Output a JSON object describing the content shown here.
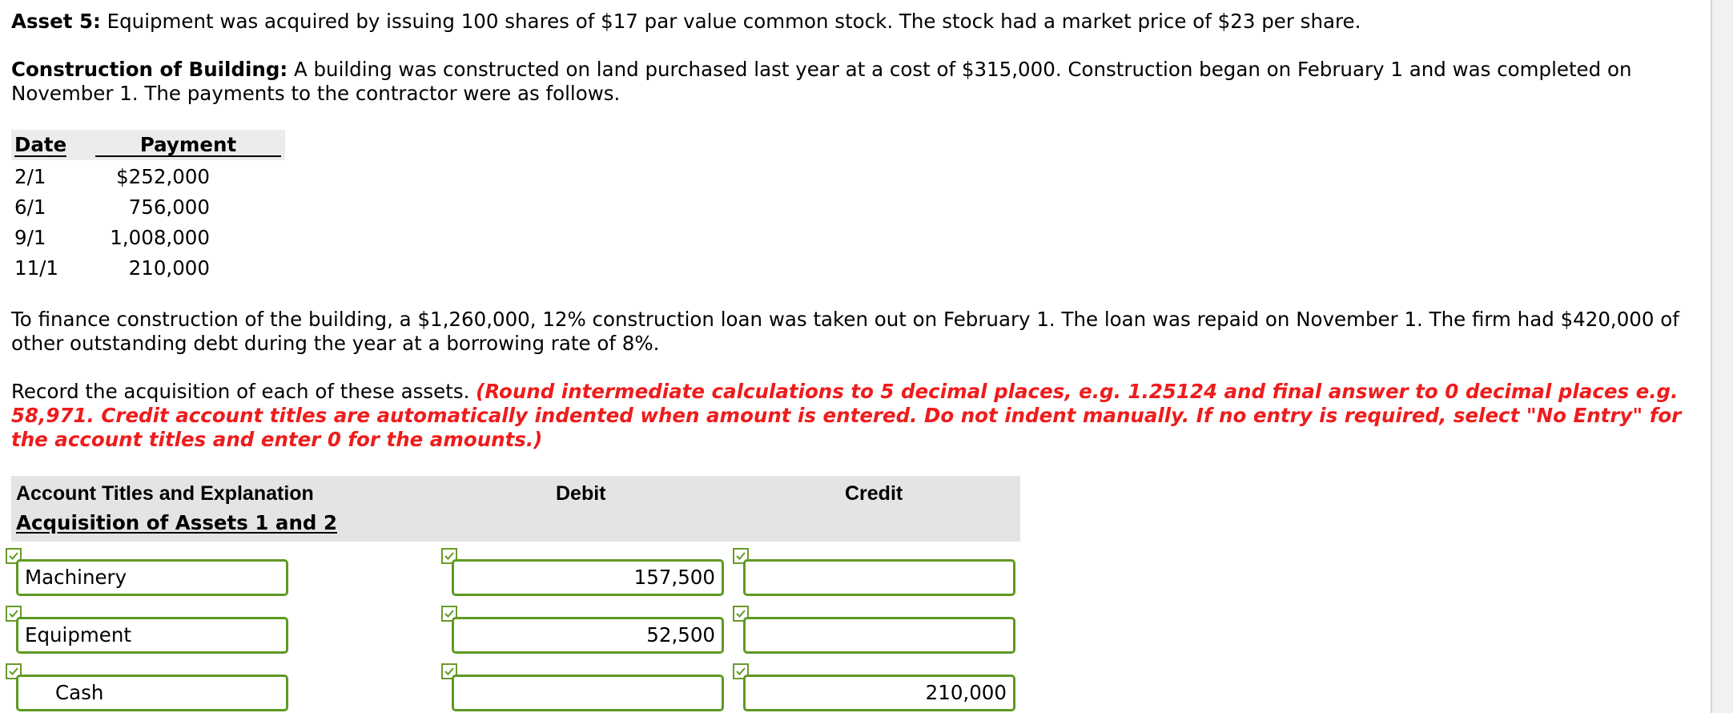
{
  "asset5": {
    "label": "Asset 5:",
    "text": " Equipment was acquired by issuing 100 shares of $17 par value common stock. The stock had a market price of $23 per share."
  },
  "construction": {
    "label": "Construction of Building:",
    "text": " A building was constructed on land purchased last year at a cost of $315,000. Construction began on February 1 and was completed on November 1. The payments to the contractor were as follows."
  },
  "payments": {
    "date_header": "Date",
    "amount_header": "Payment",
    "rows": [
      {
        "date": "2/1",
        "amount": "$252,000"
      },
      {
        "date": "6/1",
        "amount": "756,000"
      },
      {
        "date": "9/1",
        "amount": "1,008,000"
      },
      {
        "date": "11/1",
        "amount": "210,000"
      }
    ]
  },
  "finance_text": "To finance construction of the building, a $1,260,000, 12% construction loan was taken out on February 1. The loan was repaid on November 1. The firm had $420,000 of other outstanding debt during the year at a borrowing rate of 8%.",
  "instructions": {
    "text": "Record the acquisition of each of these assets. ",
    "note": "(Round intermediate calculations to 5 decimal places, e.g. 1.25124 and final answer to 0 decimal places e.g. 58,971. Credit account titles are automatically indented when amount is entered. Do not indent manually. If no entry is required, select \"No Entry\" for the account titles and enter 0 for the amounts.)"
  },
  "journal": {
    "headers": {
      "account": "Account Titles and Explanation",
      "debit": "Debit",
      "credit": "Credit"
    },
    "section": "Acquisition of Assets 1 and 2",
    "rows": [
      {
        "account": "Machinery",
        "debit": "157,500",
        "credit": ""
      },
      {
        "account": "Equipment",
        "debit": "52,500",
        "credit": ""
      },
      {
        "account": "Cash",
        "debit": "",
        "credit": "210,000"
      }
    ]
  },
  "colors": {
    "field_border": "#5e9a22",
    "note": "#ee1c1c",
    "header_bg": "#e4e4e4"
  }
}
